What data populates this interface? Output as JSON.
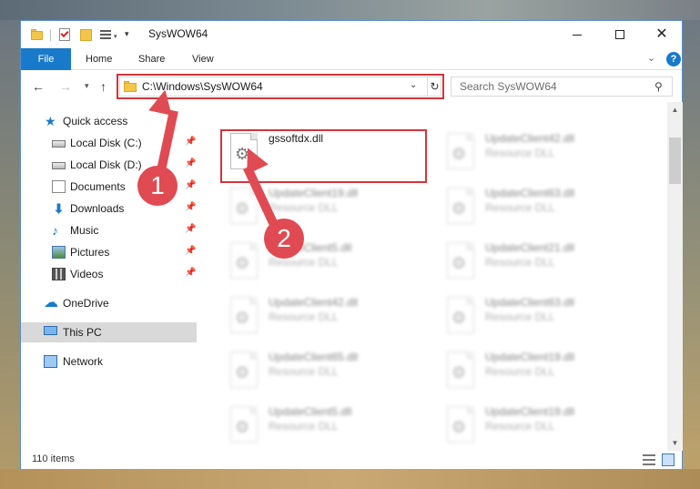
{
  "window": {
    "title": "SysWOW64"
  },
  "ribbon": {
    "tabs": [
      "File",
      "Home",
      "Share",
      "View"
    ]
  },
  "navbar": {
    "address": "C:\\Windows\\SysWOW64",
    "search_placeholder": "Search SysWOW64"
  },
  "sidebar": {
    "items": [
      {
        "label": "Quick access",
        "icon": "star-icon",
        "pinned": false
      },
      {
        "label": "Local Disk (C:)",
        "icon": "drive-icon",
        "pinned": true
      },
      {
        "label": "Local Disk (D:)",
        "icon": "drive-icon",
        "pinned": true
      },
      {
        "label": "Documents",
        "icon": "documents-icon",
        "pinned": true
      },
      {
        "label": "Downloads",
        "icon": "download-icon",
        "pinned": true
      },
      {
        "label": "Music",
        "icon": "music-icon",
        "pinned": true
      },
      {
        "label": "Pictures",
        "icon": "pictures-icon",
        "pinned": true
      },
      {
        "label": "Videos",
        "icon": "videos-icon",
        "pinned": true
      },
      {
        "label": "OneDrive",
        "icon": "onedrive-icon",
        "pinned": false
      },
      {
        "label": "This PC",
        "icon": "computer-icon",
        "pinned": false,
        "selected": true
      },
      {
        "label": "Network",
        "icon": "network-icon",
        "pinned": false
      }
    ]
  },
  "files": [
    {
      "name": "gssoftdx.dll",
      "type": ""
    },
    {
      "name": "UpdateClient42.dll",
      "type": "Resource DLL"
    },
    {
      "name": "UpdateClient19.dll",
      "type": "Resource DLL"
    },
    {
      "name": "UpdateClient63.dll",
      "type": "Resource DLL"
    },
    {
      "name": "UpdateClient5.dll",
      "type": "Resource DLL"
    },
    {
      "name": "UpdateClient21.dll",
      "type": "Resource DLL"
    },
    {
      "name": "UpdateClient42.dll",
      "type": "Resource DLL"
    },
    {
      "name": "UpdateClient63.dll",
      "type": "Resource DLL"
    },
    {
      "name": "UpdateClient65.dll",
      "type": "Resource DLL"
    },
    {
      "name": "UpdateClient19.dll",
      "type": "Resource DLL"
    },
    {
      "name": "UpdateClient5.dll",
      "type": "Resource DLL"
    },
    {
      "name": "UpdateClient19.dll",
      "type": "Resource DLL"
    }
  ],
  "status": {
    "item_count": "110 items"
  },
  "callouts": {
    "step1": "1",
    "step2": "2"
  },
  "colors": {
    "accent": "#1979ca",
    "highlight": "#d3343b",
    "callout": "#e04a52"
  }
}
